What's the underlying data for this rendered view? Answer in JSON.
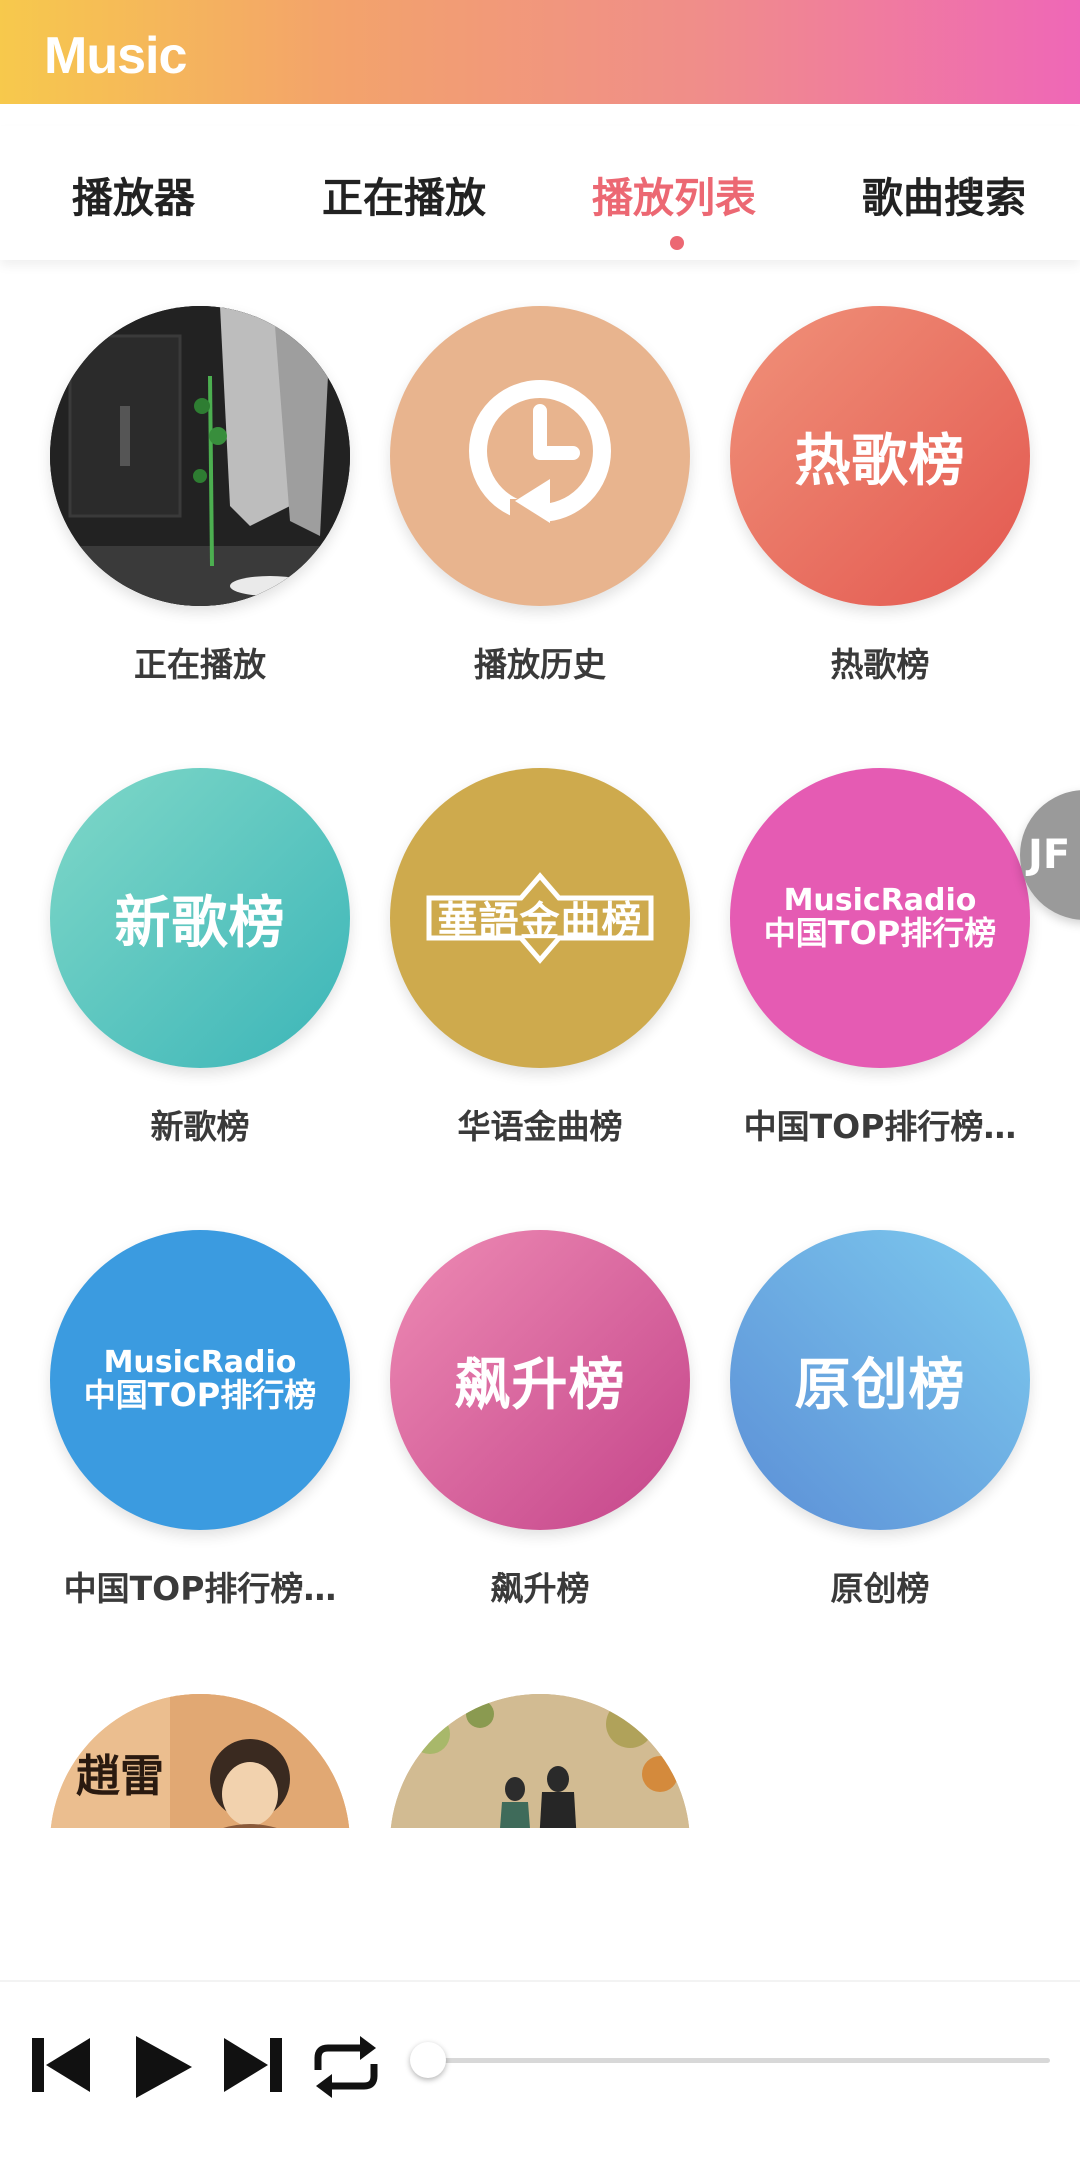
{
  "header": {
    "title": "Music"
  },
  "tabs": [
    {
      "label": "播放器"
    },
    {
      "label": "正在播放"
    },
    {
      "label": "播放列表"
    },
    {
      "label": "歌曲搜索"
    }
  ],
  "active_tab": "播放列表",
  "grid": {
    "items": [
      {
        "label": "正在播放",
        "art": ""
      },
      {
        "label": "播放历史",
        "art": ""
      },
      {
        "label": "热歌榜",
        "art": "热歌榜"
      },
      {
        "label": "新歌榜",
        "art": "新歌榜"
      },
      {
        "label": "华语金曲榜",
        "art": "華語金曲榜"
      },
      {
        "label": "中国TOP排行榜…",
        "art_line1": "MusicRadio",
        "art_line2": "中国TOP排行榜"
      },
      {
        "label": "中国TOP排行榜…",
        "art_line1": "MusicRadio",
        "art_line2": "中国TOP排行榜"
      },
      {
        "label": "飙升榜",
        "art": "飙升榜"
      },
      {
        "label": "原创榜",
        "art": "原创榜"
      },
      {
        "label": "",
        "art": "趙雷"
      },
      {
        "label": "",
        "art": ""
      }
    ]
  },
  "floating_bubble": {
    "text": "JF"
  },
  "player": {
    "controls": [
      "previous-icon",
      "play-icon",
      "next-icon",
      "repeat-icon"
    ],
    "progress": 0
  },
  "colors": {
    "accent": "#ec6873",
    "header_gradient": [
      "#f7c94c",
      "#ef67b7"
    ]
  }
}
